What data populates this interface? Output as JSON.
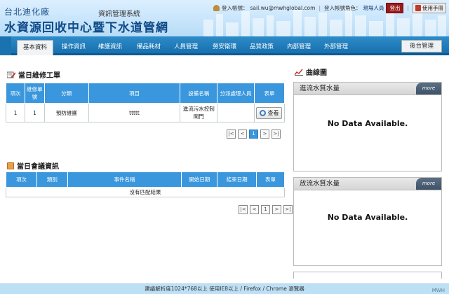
{
  "header": {
    "org": "台北迪化廠",
    "sys": "資訊管理系統",
    "title": "水資源回收中心暨下水道管網",
    "login_account_label": "登入帳號：",
    "login_account": "sail.wu@mwhglobal.com",
    "login_role_label": "登入帳號角色：",
    "login_role": "現場人員",
    "logout": "登出",
    "manual": "使用手冊"
  },
  "nav": {
    "tabs": [
      "基本資料",
      "操作資訊",
      "維護資訊",
      "備品耗材",
      "人員管理",
      "勞安衛環",
      "品質政策",
      "內部管理",
      "外部管理"
    ],
    "backend": "後台管理"
  },
  "work_orders": {
    "title": "當日維修工單",
    "headers": [
      "項次",
      "維修單號",
      "分類",
      "項目",
      "設備名稱",
      "分派處理人員",
      "表單"
    ],
    "rows": [
      {
        "no": "1",
        "order": "1",
        "category": "預防維護",
        "item": "ttttt",
        "equipment": "進流污水控制閘門",
        "assignee": "",
        "form": "查看"
      }
    ]
  },
  "meetings": {
    "title": "當日會議資訊",
    "headers": [
      "項次",
      "類別",
      "事件名稱",
      "開始日期",
      "結束日期",
      "表單"
    ],
    "empty": "沒有匹配結果"
  },
  "pager1": {
    "first": "|<",
    "prev": "<",
    "current": "1",
    "next": ">",
    "last": ">|"
  },
  "pager2": {
    "first": "|<",
    "prev": "<",
    "current": "1",
    "next": ">",
    "last": ">|"
  },
  "curves": {
    "title": "曲線圖",
    "panel1_title": "進流水質水量",
    "panel2_title": "放流水質水量",
    "more": "more",
    "no_data": "No Data Available."
  },
  "footer": {
    "text": "建議解析度1024*768以上 使用IE8以上 / Firefox / Chrome 瀏覽器",
    "logo": "MWH"
  },
  "colors": {
    "nav": "#176fae",
    "table_header": "#3a97dd",
    "logout": "#9a1b1b"
  },
  "icons": [
    "user-icon",
    "manual-icon",
    "wrench-icon",
    "calendar-icon",
    "chart-icon",
    "zoom-icon"
  ]
}
